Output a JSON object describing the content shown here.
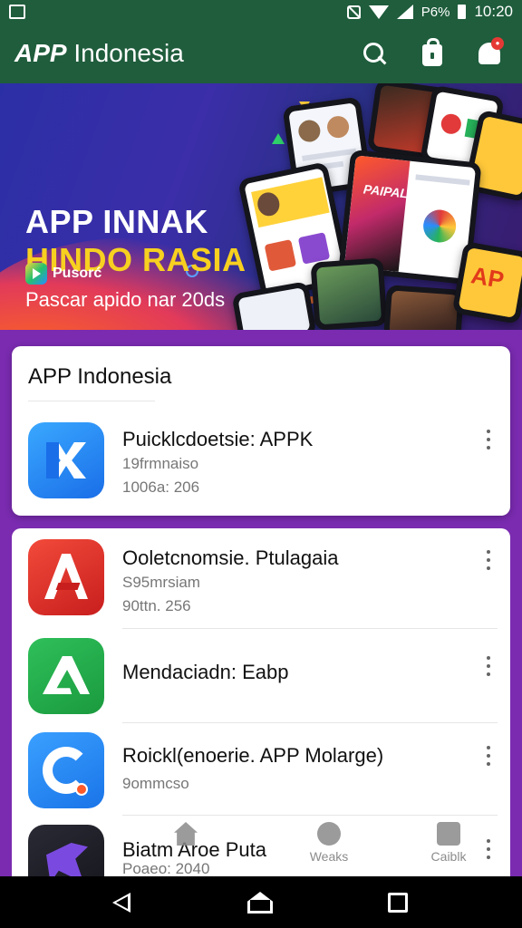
{
  "status_bar": {
    "battery_text": "P6%",
    "time": "10:20",
    "icons": [
      "notification-box-icon",
      "mute-icon",
      "wifi-icon",
      "signal-icon",
      "battery-icon"
    ]
  },
  "app_bar": {
    "title_bold": "APP",
    "title_rest": "Indonesia",
    "actions": [
      "search-icon",
      "shopping-bag-icon",
      "notification-bell-icon"
    ]
  },
  "banner": {
    "line1": "APP INNAK",
    "line2": "HINDO RASIA",
    "subtitle": "Pascar apido nar 20ds",
    "brand": "Pusorć",
    "phone_text_1": "PAIPAL",
    "phone_text_2": "AP",
    "colors": {
      "headline": "#ffffff",
      "headline_accent": "#f7d020"
    }
  },
  "section": {
    "title": "APP Indonesia"
  },
  "featured_app": {
    "name": "Puicklcdoetsie: APPK",
    "meta1": "19frmnaiso",
    "meta2": "1006a: 206",
    "icon": "blue-x-app-icon"
  },
  "app_list": [
    {
      "name": "Ooletcnomsie. Ptulagaia",
      "meta1": "S95mrsiam",
      "meta2": "90ttn. 256",
      "icon": "red-a-app-icon"
    },
    {
      "name": "Mendaciadn: Eabp",
      "icon": "green-a-app-icon"
    },
    {
      "name": "Roickl(enoerie. APP Molarge)",
      "meta1": "9ommcso",
      "icon": "blue-c-app-icon"
    },
    {
      "name": "Biatm Aroe Puta",
      "meta1": "Poaeo: 2040",
      "icon": "dark-bird-app-icon"
    }
  ],
  "bottom_nav": {
    "item1": "",
    "item2": "Weaks",
    "item3": "Caiblk"
  },
  "accent_colors": {
    "app_bar": "#1f5d3c",
    "background": "#7a2bb0"
  }
}
